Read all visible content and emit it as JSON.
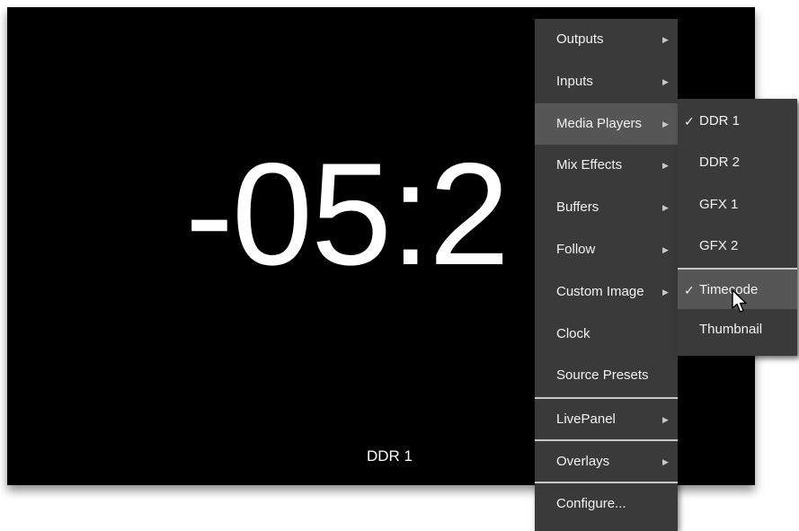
{
  "monitor": {
    "timecode": "-05:2",
    "source_label": "DDR 1"
  },
  "context_menu": {
    "items": [
      {
        "label": "Outputs",
        "has_submenu": true
      },
      {
        "label": "Inputs",
        "has_submenu": true
      },
      {
        "label": "Media Players",
        "has_submenu": true,
        "active": true
      },
      {
        "label": "Mix Effects",
        "has_submenu": true
      },
      {
        "label": "Buffers",
        "has_submenu": true
      },
      {
        "label": "Follow",
        "has_submenu": true
      },
      {
        "label": "Custom Image",
        "has_submenu": true
      },
      {
        "label": "Clock",
        "has_submenu": false
      },
      {
        "label": "Source Presets",
        "has_submenu": false
      },
      {
        "label": "LivePanel",
        "has_submenu": true
      },
      {
        "label": "Overlays",
        "has_submenu": true
      },
      {
        "label": "Configure...",
        "has_submenu": false
      }
    ]
  },
  "submenu": {
    "items": [
      {
        "label": "DDR 1",
        "checked": true
      },
      {
        "label": "DDR 2",
        "checked": false
      },
      {
        "label": "GFX 1",
        "checked": false
      },
      {
        "label": "GFX 2",
        "checked": false
      },
      {
        "label": "Timecode",
        "checked": true,
        "hovered": true
      },
      {
        "label": "Thumbnail",
        "checked": false
      }
    ]
  },
  "glyphs": {
    "submenu_arrow": "▶",
    "check": "✓"
  },
  "colors": {
    "monitor_bg": "#000000",
    "menu_bg": "#3a3a3a",
    "menu_highlight": "#565656",
    "menu_text": "#f2f2f2"
  }
}
